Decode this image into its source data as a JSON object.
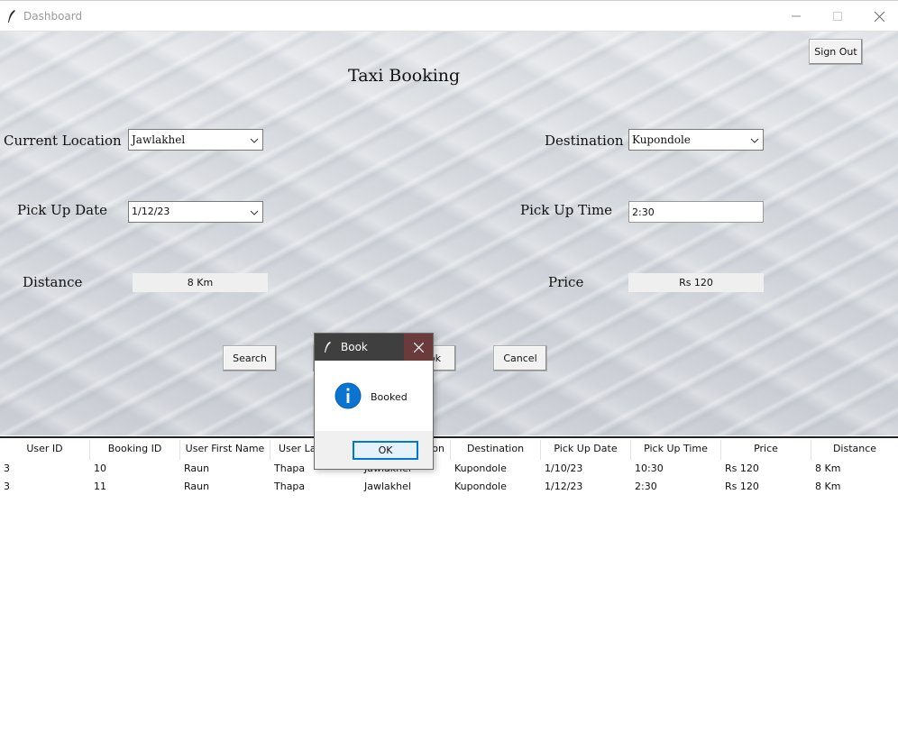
{
  "window": {
    "title": "Dashboard",
    "minimize_icon": "minimize-icon",
    "maximize_icon": "maximize-icon",
    "close_icon": "close-icon"
  },
  "header": {
    "sign_out_label": "Sign Out",
    "heading": "Taxi Booking"
  },
  "form": {
    "current_location_label": "Current Location",
    "current_location_value": "Jawlakhel",
    "destination_label": "Destination",
    "destination_value": "Kupondole",
    "pickup_date_label": "Pick Up Date",
    "pickup_date_value": "1/12/23",
    "pickup_time_label": "Pick Up Time",
    "pickup_time_value": "2:30",
    "distance_label": "Distance",
    "distance_value": "8 Km",
    "price_label": "Price",
    "price_value": "Rs 120"
  },
  "actions": {
    "search_label": "Search",
    "book_label_visible": "ok",
    "cancel_label": "Cancel"
  },
  "table": {
    "columns": [
      "User ID",
      "Booking ID",
      "User First Name",
      "User La",
      "on",
      "Destination",
      "Pick Up Date",
      "Pick Up Time",
      "Price",
      "Distance"
    ],
    "rows": [
      [
        "3",
        "10",
        "Raun",
        "Thapa",
        "Jawlakhel",
        "Kupondole",
        "1/10/23",
        "10:30",
        "Rs 120",
        "8 Km"
      ],
      [
        "3",
        "11",
        "Raun",
        "Thapa",
        "Jawlakhel",
        "Kupondole",
        "1/12/23",
        "2:30",
        "Rs 120",
        "8 Km"
      ]
    ]
  },
  "dialog": {
    "title": "Book",
    "message": "Booked",
    "ok_label": "OK",
    "icon": "info-icon"
  },
  "colors": {
    "dialog_titlebar": "#3f3f3f",
    "dialog_close_hover": "#6b3a3a",
    "ok_border": "#0078d7",
    "info_blue": "#0a74d1"
  }
}
